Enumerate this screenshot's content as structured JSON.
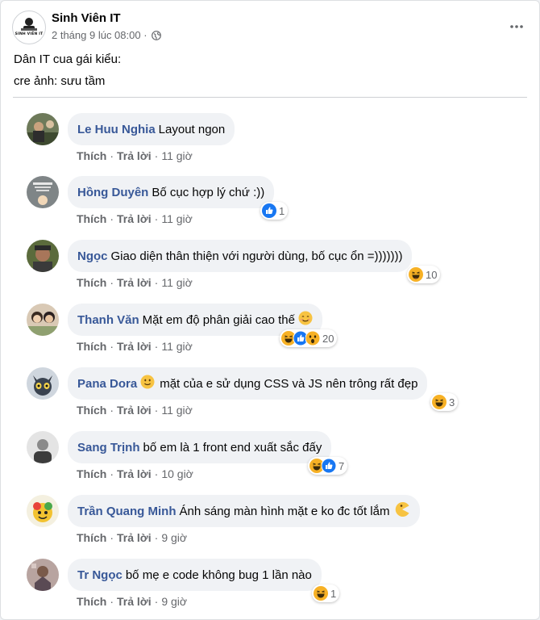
{
  "post": {
    "page_name": "Sinh Viên IT",
    "logo_text": "SINH VIÊN IT",
    "timestamp": "2 tháng 9 lúc 08:00",
    "privacy_dot": "·",
    "text_line1": "Dân IT cua gái kiểu:",
    "text_line2": "cre ảnh: sưu tầm"
  },
  "labels": {
    "like": "Thích",
    "reply": "Trả lời",
    "sep": "·"
  },
  "comments": [
    {
      "author": "Le Huu Nghia",
      "text": "Layout ngon",
      "time": "11 giờ",
      "reaction_count": "",
      "reactions": []
    },
    {
      "author": "Hồng Duyên",
      "text": "Bố cục hợp lý chứ :))",
      "time": "11 giờ",
      "reaction_count": "1",
      "reactions": [
        "like"
      ]
    },
    {
      "author": "Ngọc",
      "text": "Giao diện thân thiện với người dùng, bố cục ổn =)))))))",
      "time": "11 giờ",
      "reaction_count": "10",
      "reactions": [
        "haha"
      ]
    },
    {
      "author": "Thanh Văn",
      "text": "Mặt em độ phân giải cao thế",
      "time": "11 giờ",
      "reaction_count": "20",
      "reactions": [
        "haha",
        "like",
        "wow"
      ]
    },
    {
      "author": "Pana Dora",
      "text": "mặt của e sử dụng CSS và JS nên trông rất đẹp",
      "time": "11 giờ",
      "reaction_count": "3",
      "reactions": [
        "haha"
      ]
    },
    {
      "author": "Sang Trịnh",
      "text": "bố em là 1 front end xuất sắc đấy",
      "time": "10 giờ",
      "reaction_count": "7",
      "reactions": [
        "haha",
        "like"
      ]
    },
    {
      "author": "Trần Quang Minh",
      "text": "Ánh sáng màn hình mặt e ko đc tốt lắm",
      "time": "9 giờ",
      "reaction_count": "",
      "reactions": []
    },
    {
      "author": "Tr Ngọc",
      "text": "bố mẹ e code không bug 1 lần nào",
      "time": "9 giờ",
      "reaction_count": "1",
      "reactions": [
        "haha"
      ]
    }
  ],
  "colors": {
    "author_link": "#385898",
    "meta_gray": "#65676b",
    "like_blue": "#1877f2",
    "haha_yellow": "#f7b125"
  }
}
